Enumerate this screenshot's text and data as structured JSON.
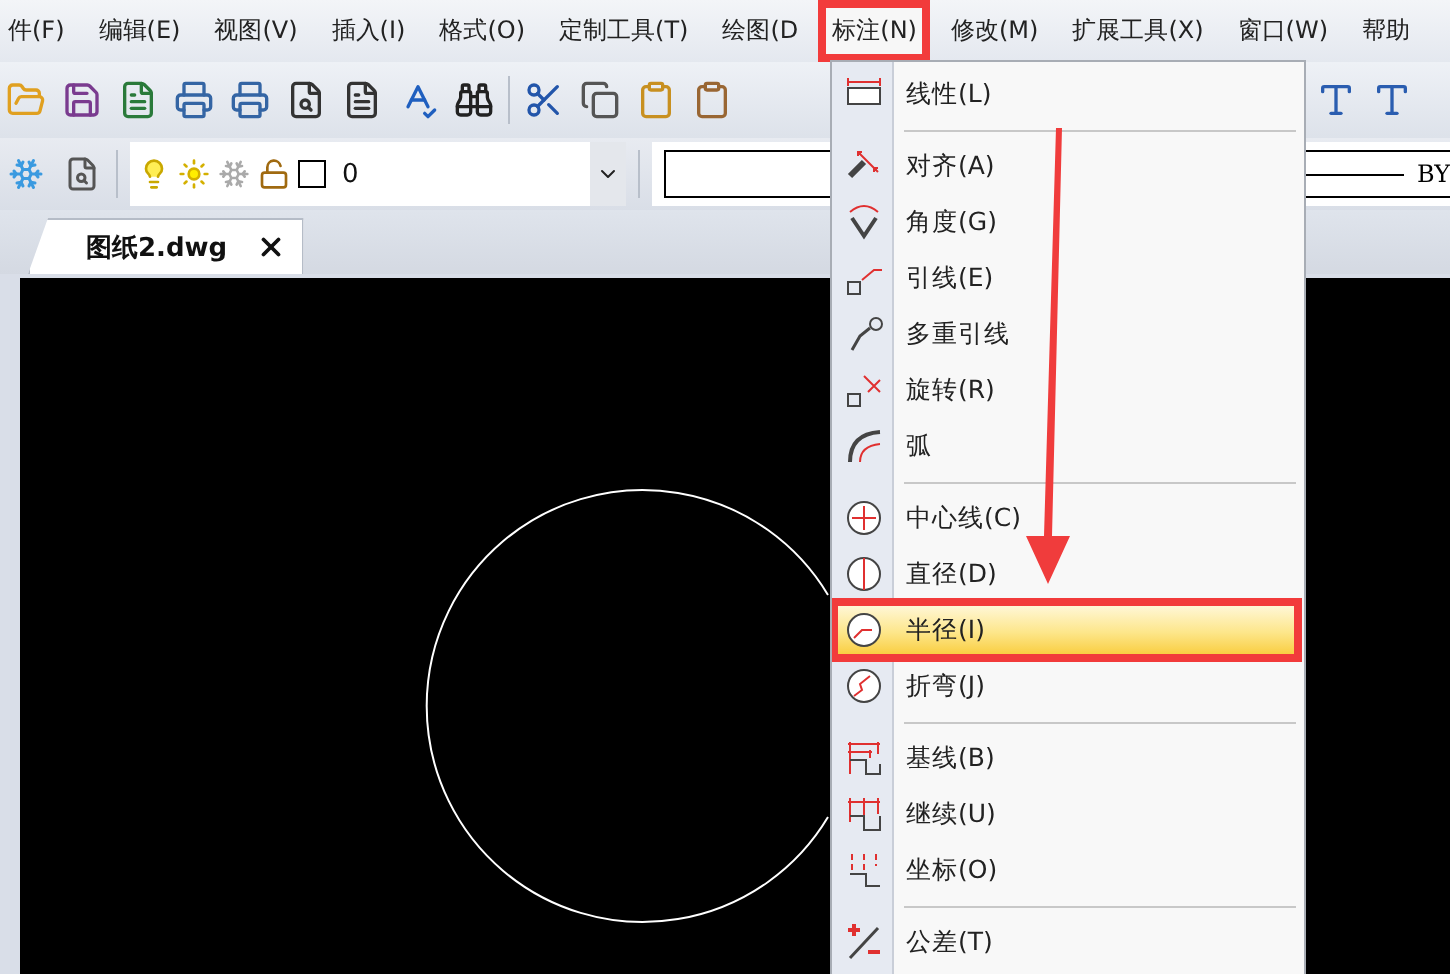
{
  "menu_bar": [
    {
      "label": "件(F)",
      "selected": false
    },
    {
      "label": "编辑(E)",
      "selected": false
    },
    {
      "label": "视图(V)",
      "selected": false
    },
    {
      "label": "插入(I)",
      "selected": false
    },
    {
      "label": "格式(O)",
      "selected": false
    },
    {
      "label": "定制工具(T)",
      "selected": false
    },
    {
      "label": "绘图(D",
      "selected": false
    },
    {
      "label": "标注(N)",
      "selected": true
    },
    {
      "label": "修改(M)",
      "selected": false
    },
    {
      "label": "扩展工具(X)",
      "selected": false
    },
    {
      "label": "窗口(W)",
      "selected": false
    },
    {
      "label": "帮助",
      "selected": false
    }
  ],
  "layer_control": {
    "layer_name": "0"
  },
  "linetype_control": {
    "value": "BY"
  },
  "document_tabs": [
    {
      "label": "图纸2.dwg",
      "selected": true
    }
  ],
  "dropdown_menu": {
    "items": [
      {
        "kind": "item",
        "label": "线性(L)",
        "selected": false
      },
      {
        "kind": "separator"
      },
      {
        "kind": "item",
        "label": "对齐(A)",
        "selected": false
      },
      {
        "kind": "item",
        "label": "角度(G)",
        "selected": false
      },
      {
        "kind": "item",
        "label": "引线(E)",
        "selected": false
      },
      {
        "kind": "item",
        "label": "多重引线",
        "selected": false
      },
      {
        "kind": "item",
        "label": "旋转(R)",
        "selected": false
      },
      {
        "kind": "item",
        "label": "弧",
        "selected": false
      },
      {
        "kind": "separator"
      },
      {
        "kind": "item",
        "label": "中心线(C)",
        "selected": false
      },
      {
        "kind": "item",
        "label": "直径(D)",
        "selected": false
      },
      {
        "kind": "item",
        "label": "半径(I)",
        "selected": true
      },
      {
        "kind": "item",
        "label": "折弯(J)",
        "selected": false
      },
      {
        "kind": "separator"
      },
      {
        "kind": "item",
        "label": "基线(B)",
        "selected": false
      },
      {
        "kind": "item",
        "label": "继续(U)",
        "selected": false
      },
      {
        "kind": "item",
        "label": "坐标(O)",
        "selected": false
      },
      {
        "kind": "separator"
      },
      {
        "kind": "item",
        "label": "公差(T)",
        "selected": false
      }
    ]
  }
}
